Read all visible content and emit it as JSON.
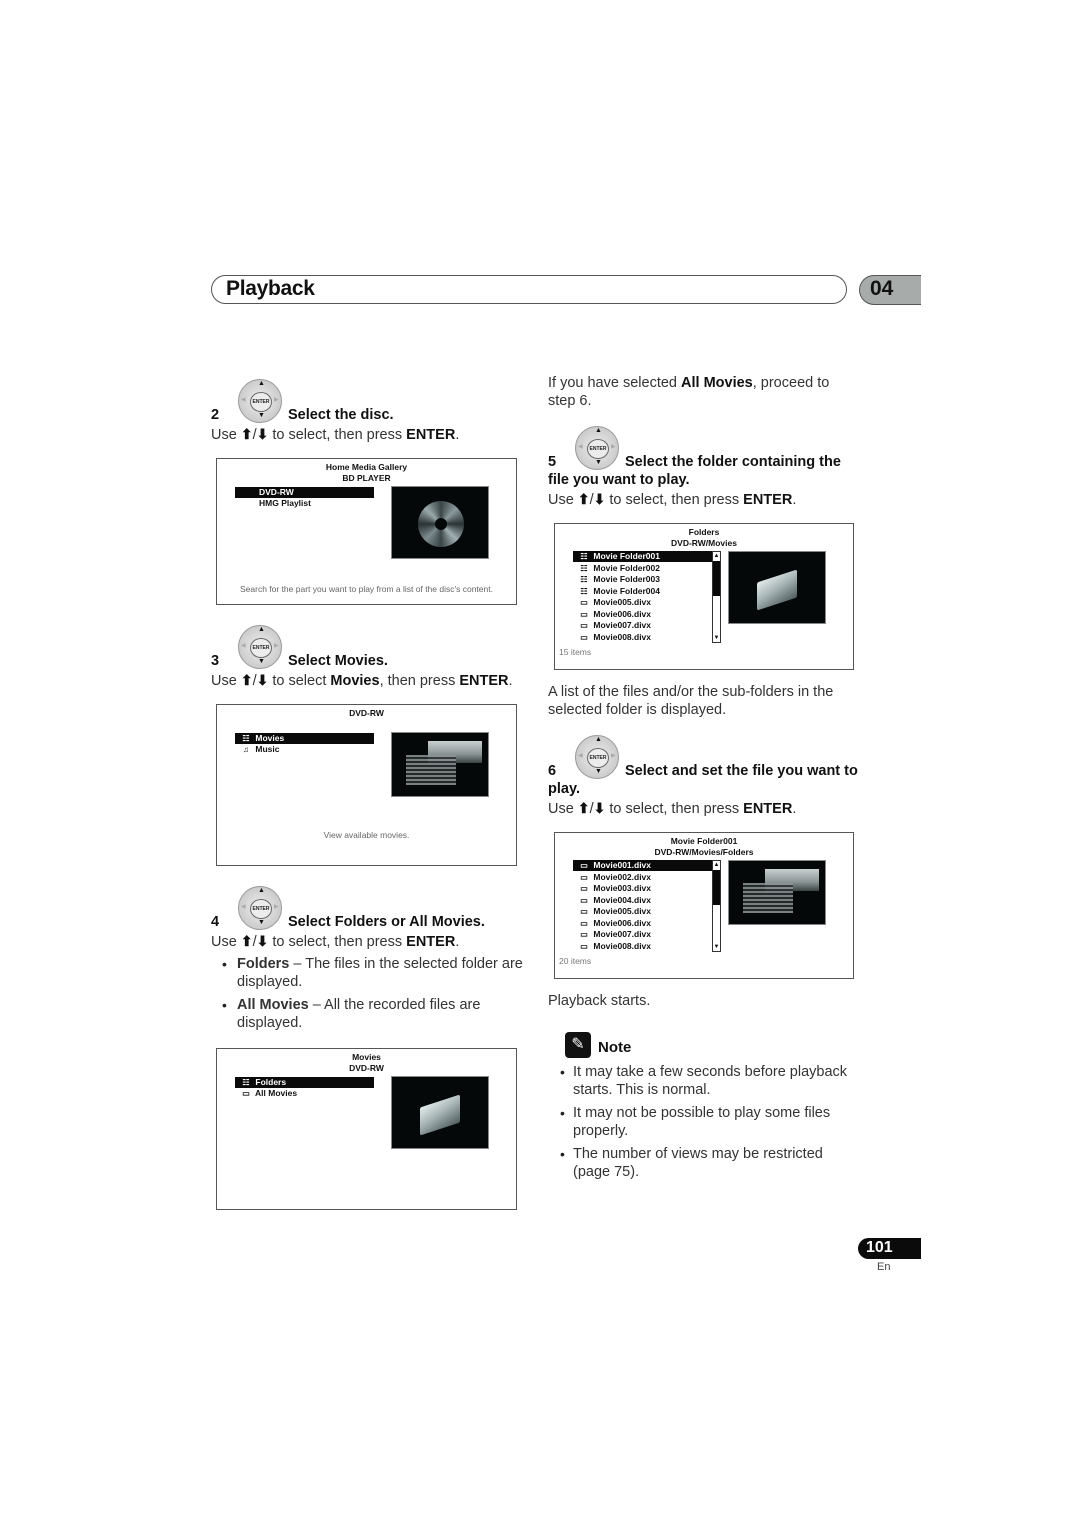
{
  "header": {
    "section_title": "Playback",
    "chapter_number": "04"
  },
  "left_column": {
    "step2": {
      "number": "2",
      "title": "Select the disc.",
      "instruction_prefix": "Use",
      "instruction_mid": "to select, then press",
      "instruction_key": "ENTER",
      "instruction_end": ".",
      "screen": {
        "title_line1": "Home Media Gallery",
        "title_line2": "BD PLAYER",
        "items": [
          {
            "label": "DVD-RW",
            "selected": true
          },
          {
            "label": "HMG Playlist",
            "selected": false
          }
        ],
        "caption": "Search for the part you want to play from a list of the disc's content."
      }
    },
    "step3": {
      "number": "3",
      "title": "Select Movies.",
      "instruction_prefix": "Use",
      "instruction_mid": "to select",
      "instruction_bold": "Movies",
      "instruction_mid2": ", then press",
      "instruction_key": "ENTER",
      "instruction_end": ".",
      "screen": {
        "title_line1": "DVD-RW",
        "items": [
          {
            "label": "Movies",
            "icon": "movie-folder-icon",
            "selected": true
          },
          {
            "label": "Music",
            "icon": "music-folder-icon",
            "selected": false
          }
        ],
        "caption": "View available movies."
      }
    },
    "step4": {
      "number": "4",
      "title": "Select Folders or All Movies.",
      "instruction_prefix": "Use",
      "instruction_mid": "to select, then press",
      "instruction_key": "ENTER",
      "instruction_end": ".",
      "bullets": [
        {
          "term": "Folders",
          "text": " – The files in the selected folder are displayed."
        },
        {
          "term": "All Movies",
          "text": " – All the recorded files are displayed."
        }
      ],
      "screen": {
        "title_line1": "Movies",
        "title_line2": "DVD-RW",
        "items": [
          {
            "label": "Folders",
            "icon": "folders-icon",
            "selected": true
          },
          {
            "label": "All Movies",
            "icon": "movie-file-icon",
            "selected": false
          }
        ]
      }
    }
  },
  "right_column": {
    "intro": {
      "prefix": "If you have selected",
      "bold": "All Movies",
      "suffix": ", proceed to step 6."
    },
    "step5": {
      "number": "5",
      "title_line1": "Select the folder containing the",
      "title_line2": "file you want to play.",
      "instruction_prefix": "Use",
      "instruction_mid": "to select, then press",
      "instruction_key": "ENTER",
      "instruction_end": ".",
      "screen": {
        "title_line1": "Folders",
        "title_line2": "DVD-RW/Movies",
        "items": [
          {
            "label": "Movie Folder001",
            "icon": "folders-icon",
            "selected": true
          },
          {
            "label": "Movie Folder002",
            "icon": "folders-icon",
            "selected": false
          },
          {
            "label": "Movie Folder003",
            "icon": "folders-icon",
            "selected": false
          },
          {
            "label": "Movie Folder004",
            "icon": "folders-icon",
            "selected": false
          },
          {
            "label": "Movie005.divx",
            "icon": "movie-file-icon",
            "selected": false
          },
          {
            "label": "Movie006.divx",
            "icon": "movie-file-icon",
            "selected": false
          },
          {
            "label": "Movie007.divx",
            "icon": "movie-file-icon",
            "selected": false
          },
          {
            "label": "Movie008.divx",
            "icon": "movie-file-icon",
            "selected": false
          }
        ],
        "item_count": "15 items"
      },
      "after_text": "A list of the files and/or the sub-folders in the selected folder is displayed."
    },
    "step6": {
      "number": "6",
      "title_line1": "Select and set the file you want to",
      "title_line2": "play.",
      "instruction_prefix": "Use",
      "instruction_mid": "to select, then press",
      "instruction_key": "ENTER",
      "instruction_end": ".",
      "screen": {
        "title_line1": "Movie Folder001",
        "title_line2": "DVD-RW/Movies/Folders",
        "items": [
          {
            "label": "Movie001.divx",
            "icon": "movie-file-icon",
            "selected": true
          },
          {
            "label": "Movie002.divx",
            "icon": "movie-file-icon",
            "selected": false
          },
          {
            "label": "Movie003.divx",
            "icon": "movie-file-icon",
            "selected": false
          },
          {
            "label": "Movie004.divx",
            "icon": "movie-file-icon",
            "selected": false
          },
          {
            "label": "Movie005.divx",
            "icon": "movie-file-icon",
            "selected": false
          },
          {
            "label": "Movie006.divx",
            "icon": "movie-file-icon",
            "selected": false
          },
          {
            "label": "Movie007.divx",
            "icon": "movie-file-icon",
            "selected": false
          },
          {
            "label": "Movie008.divx",
            "icon": "movie-file-icon",
            "selected": false
          }
        ],
        "item_count": "20 items"
      },
      "after_text": "Playback starts."
    },
    "note": {
      "label": "Note",
      "bullets": [
        "It may take a few seconds before playback starts. This is normal.",
        "It may not be possible to play some files properly.",
        "The number of views may be restricted (page 75)."
      ]
    }
  },
  "remote_pad": {
    "center_label": "ENTER",
    "up_glyph": "▲",
    "down_glyph": "▼",
    "left_glyph": "◀",
    "right_glyph": "▶"
  },
  "glyphs": {
    "up_arrow": "⬆",
    "down_arrow": "⬇",
    "slash": "/",
    "bullet": "•",
    "scroll_up": "▲",
    "scroll_down": "▼",
    "folders_icon": "☷",
    "movie_file_icon": "▭",
    "music_icon": "♫",
    "note_icon": "✎"
  },
  "footer": {
    "page_number": "101",
    "language": "En"
  }
}
